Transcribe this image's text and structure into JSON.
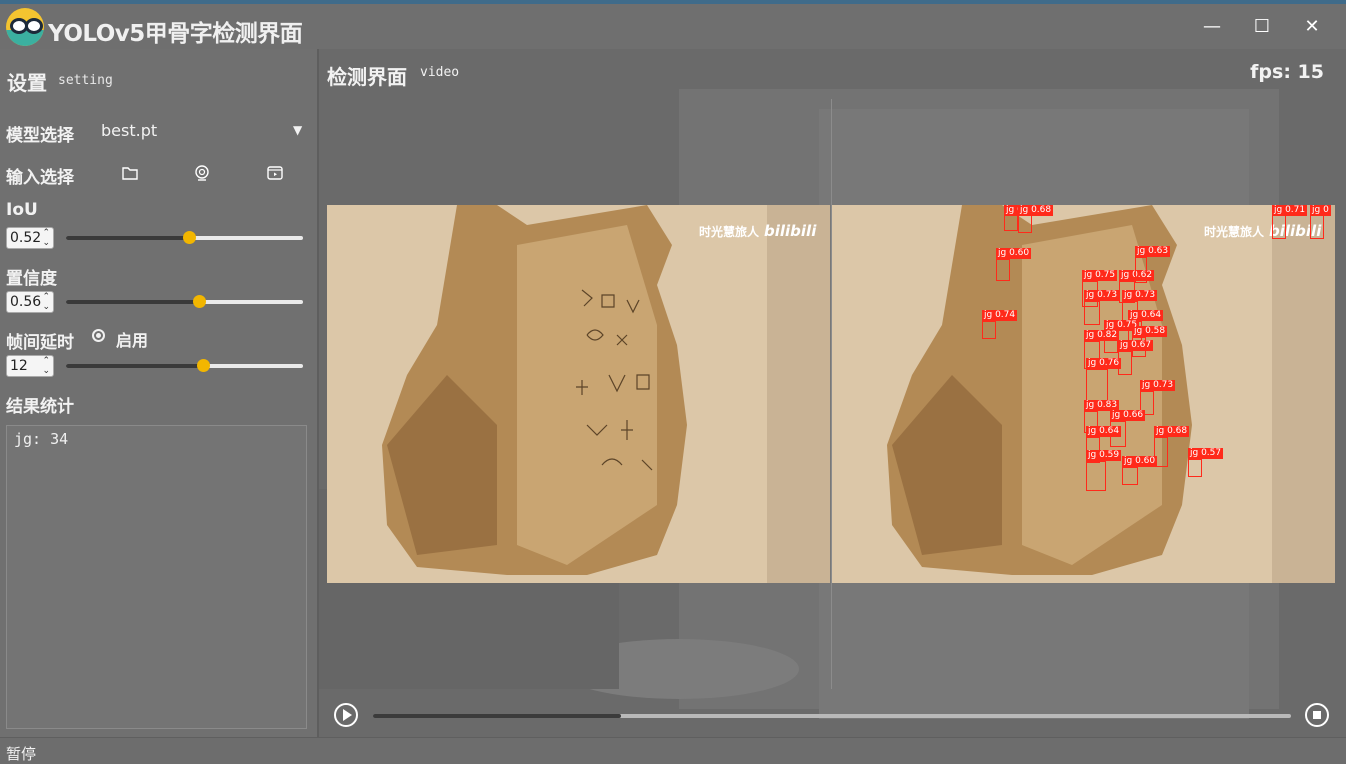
{
  "window": {
    "title": "YOLOv5甲骨字检测界面",
    "minimize_glyph": "—",
    "maximize_glyph": "☐",
    "close_glyph": "✕"
  },
  "sidebar": {
    "title": "设置",
    "subtitle": "setting",
    "model_label": "模型选择",
    "model_value": "best.pt",
    "input_label": "输入选择",
    "input_icons": [
      "folder-icon",
      "webcam-icon",
      "video-file-icon"
    ],
    "iou_label": "IoU",
    "iou_value": "0.52",
    "iou_level": 0.52,
    "conf_label": "置信度",
    "conf_value": "0.56",
    "conf_level": 0.56,
    "delay_label": "帧间延时",
    "delay_enable_label": "启用",
    "delay_value": "12",
    "delay_level": 0.58,
    "results_label": "结果统计",
    "results_text": "jg: 34"
  },
  "main": {
    "title": "检测界面",
    "subtitle": "video",
    "fps_text": "fps: 15",
    "watermark": "时光慧旅人",
    "watermark_brand": "bilibili",
    "progress": 0.27
  },
  "detections": [
    {
      "label": "jg 0.6"
    },
    {
      "label": "jg 0.68"
    },
    {
      "label": "jg 0.60"
    },
    {
      "label": "jg 0.74"
    },
    {
      "label": "jg 0.75"
    },
    {
      "label": "jg 0.62"
    },
    {
      "label": "jg 0.63"
    },
    {
      "label": "jg 0.73"
    },
    {
      "label": "jg 0.73"
    },
    {
      "label": "jg 0.64"
    },
    {
      "label": "jg 0.75"
    },
    {
      "label": "jg 0.58"
    },
    {
      "label": "jg 0.82"
    },
    {
      "label": "jg 0.67"
    },
    {
      "label": "jg 0.76"
    },
    {
      "label": "jg 0.73"
    },
    {
      "label": "jg 0.83"
    },
    {
      "label": "jg 0.66"
    },
    {
      "label": "jg 0.64"
    },
    {
      "label": "jg 0.68"
    },
    {
      "label": "jg 0.59"
    },
    {
      "label": "jg 0.60"
    },
    {
      "label": "jg 0.57"
    },
    {
      "label": "jg 0.71"
    },
    {
      "label": "jg 0"
    }
  ],
  "statusbar": {
    "text": "暂停"
  }
}
